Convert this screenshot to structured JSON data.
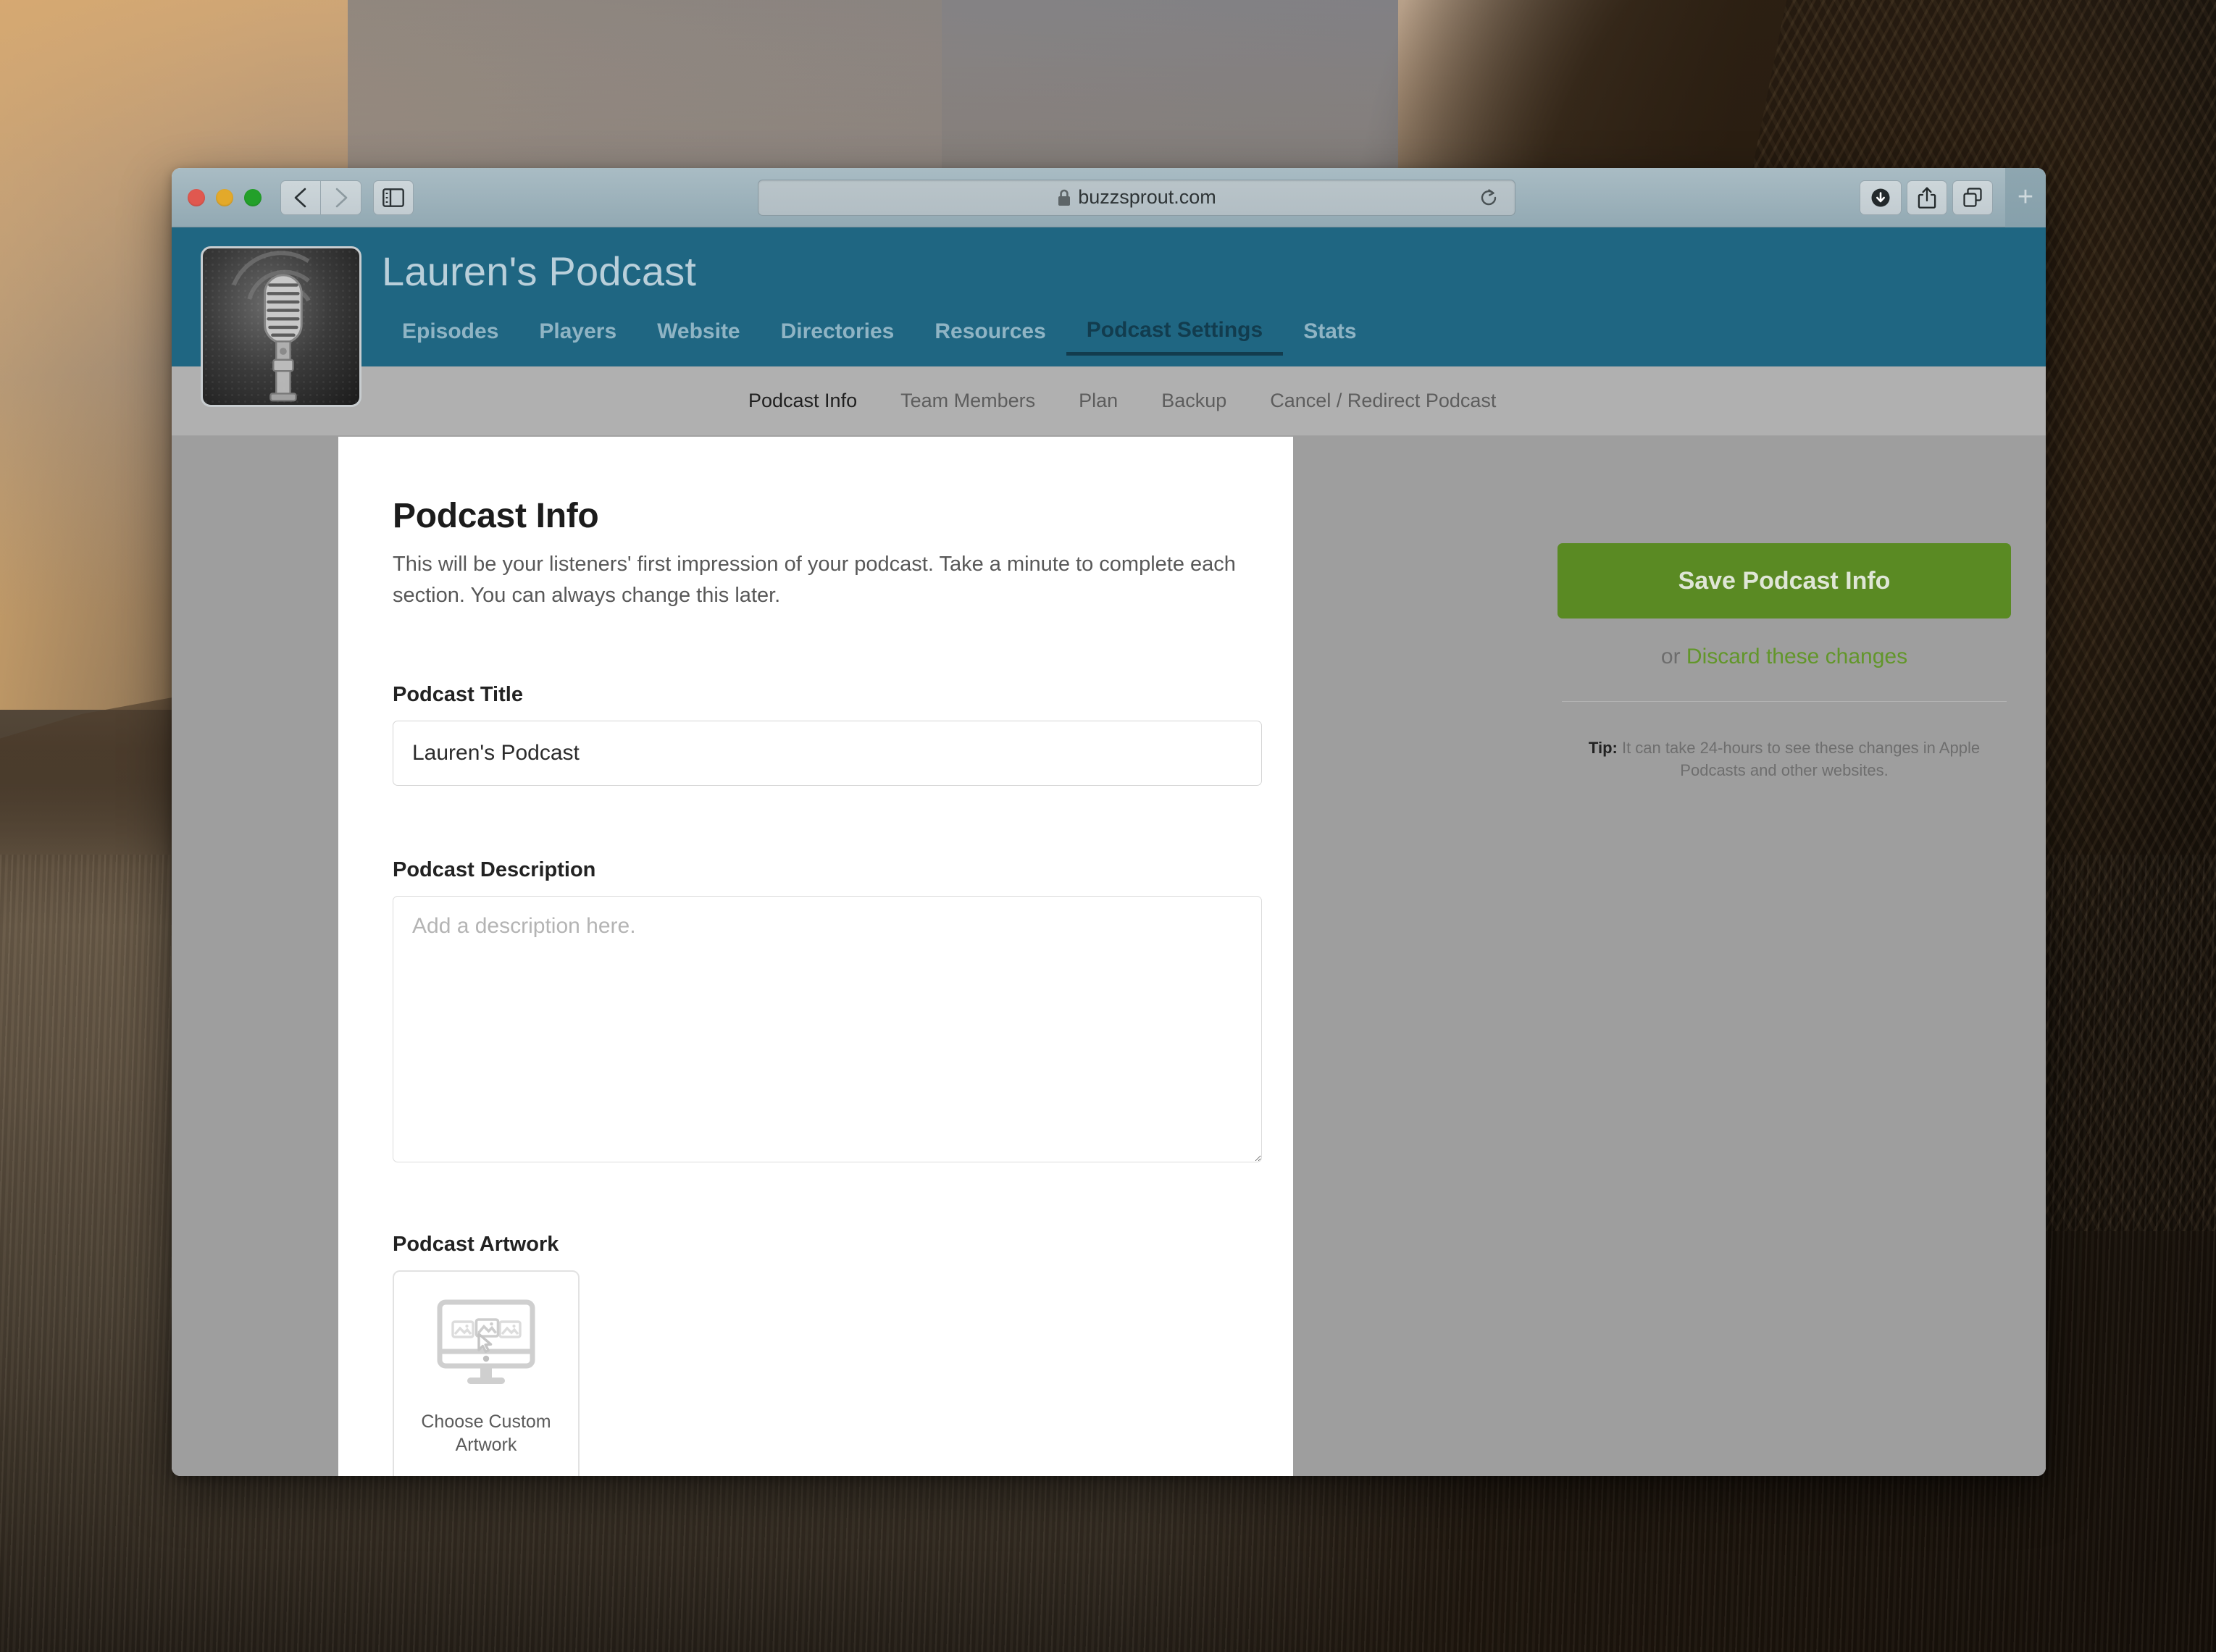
{
  "browser": {
    "url": "buzzsprout.com",
    "lock_icon": "lock-icon",
    "back_icon": "chevron-left-icon",
    "forward_icon": "chevron-right-icon",
    "sidebar_icon": "sidebar-toggle-icon",
    "reload_icon": "reload-icon",
    "downloads_icon": "downloads-icon",
    "share_icon": "share-icon",
    "tabs_icon": "show-tabs-icon",
    "newtab_label": "+"
  },
  "header": {
    "podcast_title": "Lauren's Podcast",
    "logo_icon": "microphone-artwork",
    "accent_color": "#1f6682",
    "nav": [
      {
        "label": "Episodes",
        "active": false
      },
      {
        "label": "Players",
        "active": false
      },
      {
        "label": "Website",
        "active": false
      },
      {
        "label": "Directories",
        "active": false
      },
      {
        "label": "Resources",
        "active": false
      },
      {
        "label": "Podcast Settings",
        "active": true
      },
      {
        "label": "Stats",
        "active": false
      }
    ]
  },
  "subnav": [
    {
      "label": "Podcast Info",
      "active": true
    },
    {
      "label": "Team Members",
      "active": false
    },
    {
      "label": "Plan",
      "active": false
    },
    {
      "label": "Backup",
      "active": false
    },
    {
      "label": "Cancel / Redirect Podcast",
      "active": false
    }
  ],
  "main": {
    "section_title": "Podcast Info",
    "section_desc": "This will be your listeners' first impression of your podcast. Take a minute to complete each section. You can always change this later.",
    "title_field": {
      "label": "Podcast Title",
      "value": "Lauren's Podcast",
      "placeholder": ""
    },
    "description_field": {
      "label": "Podcast Description",
      "value": "",
      "placeholder": "Add a description here."
    },
    "artwork_field": {
      "label": "Podcast Artwork",
      "chooser_label": "Choose Custom Artwork",
      "chooser_icon": "monitor-images-cursor-icon"
    }
  },
  "sidebar": {
    "save_label": "Save Podcast Info",
    "save_color": "#5a8a23",
    "or_label": "or ",
    "discard_label": "Discard these changes",
    "discard_color": "#62962a",
    "tip_prefix": "Tip:",
    "tip_body": " It can take 24-hours to see these changes in Apple Podcasts and other websites."
  }
}
